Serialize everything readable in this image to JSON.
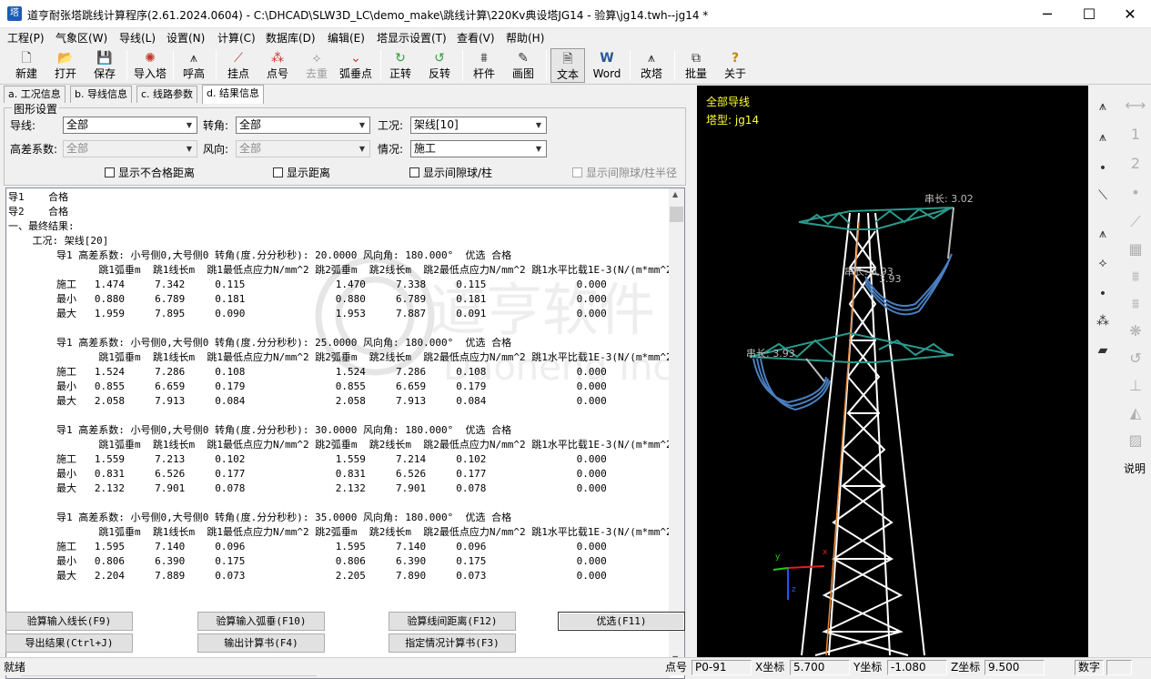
{
  "window": {
    "title": "道亨耐张塔跳线计算程序(2.61.2024.0604) - C:\\DHCAD\\SLW3D_LC\\demo_make\\跳线计算\\220Kv典设塔JG14 - 验算\\jg14.twh--jg14 *",
    "minimize": "─",
    "maximize": "☐",
    "close": "✕"
  },
  "menu": [
    "工程(P)",
    "气象区(W)",
    "导线(L)",
    "设置(N)",
    "计算(C)",
    "数据库(D)",
    "编辑(E)",
    "塔显示设置(T)",
    "查看(V)",
    "帮助(H)"
  ],
  "toolbar": [
    {
      "label": "新建",
      "icon": "new-file-icon",
      "glyph": "🗋"
    },
    {
      "label": "打开",
      "icon": "open-folder-icon",
      "glyph": "📂"
    },
    {
      "label": "保存",
      "icon": "save-disk-icon",
      "glyph": "💾"
    },
    {
      "label": "导入塔",
      "icon": "import-tower-icon",
      "glyph": "✺"
    },
    {
      "label": "呼高",
      "icon": "call-height-icon",
      "glyph": "⩚"
    },
    {
      "label": "挂点",
      "icon": "hang-point-icon",
      "glyph": "⟋"
    },
    {
      "label": "点号",
      "icon": "point-number-icon",
      "glyph": "⁂"
    },
    {
      "label": "去重",
      "icon": "dedup-icon",
      "glyph": "⟡"
    },
    {
      "label": "弧垂点",
      "icon": "sag-point-icon",
      "glyph": "⌄"
    },
    {
      "label": "正转",
      "icon": "rotate-cw-icon",
      "glyph": "↻"
    },
    {
      "label": "反转",
      "icon": "rotate-ccw-icon",
      "glyph": "↺"
    },
    {
      "label": "杆件",
      "icon": "member-icon",
      "glyph": "⩩"
    },
    {
      "label": "画图",
      "icon": "draw-icon",
      "glyph": "✎"
    },
    {
      "label": "文本",
      "icon": "text-doc-icon",
      "glyph": "🗎"
    },
    {
      "label": "Word",
      "icon": "word-icon",
      "glyph": "W"
    },
    {
      "label": "改塔",
      "icon": "modify-tower-icon",
      "glyph": "⩚"
    },
    {
      "label": "批量",
      "icon": "batch-icon",
      "glyph": "⧉"
    },
    {
      "label": "关于",
      "icon": "about-icon",
      "glyph": "?"
    }
  ],
  "tabs": [
    "a. 工况信息",
    "b. 导线信息",
    "c. 线路参数",
    "d. 结果信息"
  ],
  "graph_settings": {
    "legend": "图形设置",
    "conductor_label": "导线:",
    "conductor_value": "全部",
    "angle_label": "转角:",
    "angle_value": "全部",
    "workcase_label": "工况:",
    "workcase_value": "架线[10]",
    "height_diff_label": "高差系数:",
    "height_diff_value": "全部",
    "wind_dir_label": "风向:",
    "wind_dir_value": "全部",
    "situation_label": "情况:",
    "situation_value": "施工",
    "check_unqualified": "显示不合格距离",
    "check_distance": "显示距离",
    "check_gap_ball": "显示间隙球/柱",
    "check_gap_ball_radius": "显示间隙球/柱半径"
  },
  "results": [
    "导1    合格",
    "导2    合格",
    "一、最终结果:",
    "    工况: 架线[20]",
    "        导1 高差系数: 小号侧0,大号侧0 转角(度.分分秒秒): 20.0000 风向角: 180.000°  优选 合格",
    "               跳1弧垂m  跳1线长m  跳1最低点应力N/mm^2 跳2弧垂m  跳2线长m  跳2最低点应力N/mm^2 跳1水平比载1E-3(N/(m*mm^2",
    "        施工   1.474     7.342     0.115               1.470     7.338     0.115               0.000",
    "        最小   0.880     6.789     0.181               0.880     6.789     0.181               0.000",
    "        最大   1.959     7.895     0.090               1.953     7.887     0.091               0.000",
    "",
    "        导1 高差系数: 小号侧0,大号侧0 转角(度.分分秒秒): 25.0000 风向角: 180.000°  优选 合格",
    "               跳1弧垂m  跳1线长m  跳1最低点应力N/mm^2 跳2弧垂m  跳2线长m  跳2最低点应力N/mm^2 跳1水平比载1E-3(N/(m*mm^2",
    "        施工   1.524     7.286     0.108               1.524     7.286     0.108               0.000",
    "        最小   0.855     6.659     0.179               0.855     6.659     0.179               0.000",
    "        最大   2.058     7.913     0.084               2.058     7.913     0.084               0.000",
    "",
    "        导1 高差系数: 小号侧0,大号侧0 转角(度.分分秒秒): 30.0000 风向角: 180.000°  优选 合格",
    "               跳1弧垂m  跳1线长m  跳1最低点应力N/mm^2 跳2弧垂m  跳2线长m  跳2最低点应力N/mm^2 跳1水平比载1E-3(N/(m*mm^2",
    "        施工   1.559     7.213     0.102               1.559     7.214     0.102               0.000",
    "        最小   0.831     6.526     0.177               0.831     6.526     0.177               0.000",
    "        最大   2.132     7.901     0.078               2.132     7.901     0.078               0.000",
    "",
    "        导1 高差系数: 小号侧0,大号侧0 转角(度.分分秒秒): 35.0000 风向角: 180.000°  优选 合格",
    "               跳1弧垂m  跳1线长m  跳1最低点应力N/mm^2 跳2弧垂m  跳2线长m  跳2最低点应力N/mm^2 跳1水平比载1E-3(N/(m*mm^2",
    "        施工   1.595     7.140     0.096               1.595     7.140     0.096               0.000",
    "        最小   0.806     6.390     0.175               0.806     6.390     0.175               0.000",
    "        最大   2.204     7.889     0.073               2.205     7.890     0.073               0.000"
  ],
  "watermark": {
    "cn": "道亨软件",
    "en": "Daoheng Inc."
  },
  "buttons": {
    "check_input_length": "验算输入线长(F9)",
    "check_input_sag": "验算输入弧垂(F10)",
    "check_line_distance": "验算线间距离(F12)",
    "optimize": "优选(F11)",
    "export_results": "导出结果(Ctrl+J)",
    "output_calc_book": "输出计算书(F4)",
    "specified_calc_book": "指定情况计算书(F3)"
  },
  "view": {
    "title1": "全部导线",
    "title2": "塔型: jg14",
    "label_string_length_top": "串长: 3.02",
    "label_mid_1": "串长: 3.93",
    "label_mid_2": "3.93",
    "label_left": "串长: 3.93",
    "axis_y": "y",
    "axis_z": "z",
    "axis_x": "x"
  },
  "side_tools_label": "说明",
  "status": {
    "ready": "就绪",
    "point_label": "点号",
    "point_value": "P0-91",
    "x_label": "X坐标",
    "x_value": "5.700",
    "y_label": "Y坐标",
    "y_value": "-1.080",
    "z_label": "Z坐标",
    "z_value": "9.500",
    "numlock": "数字"
  },
  "colors": {
    "crossarm": "#2a9a8c",
    "tower": "#ffffff",
    "jumper": "#4a7fc1",
    "view_text": "#ffff33"
  }
}
